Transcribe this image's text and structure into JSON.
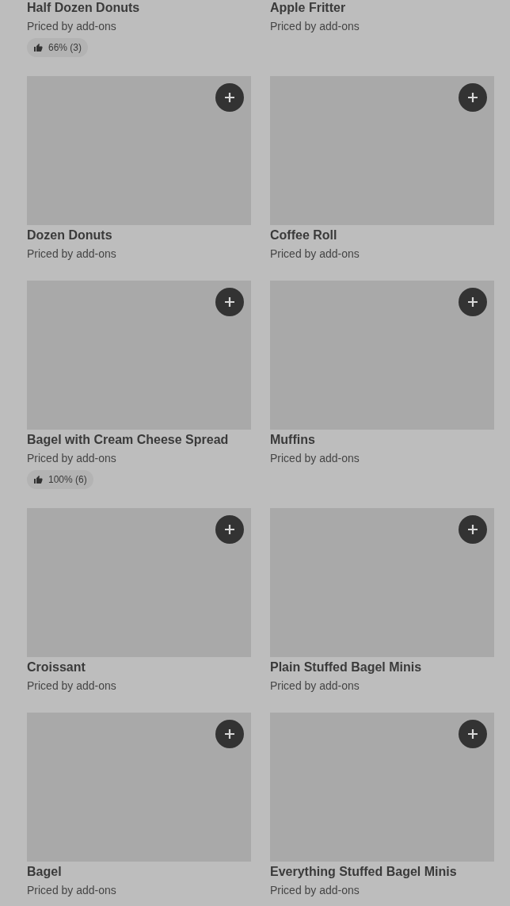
{
  "items": [
    {
      "kind": "partial",
      "name": "Half Dozen Donuts",
      "subtitle": "Priced by add-ons",
      "rating": "66% (3)"
    },
    {
      "kind": "partial",
      "name": "Apple Fritter",
      "subtitle": "Priced by add-ons"
    },
    {
      "kind": "full",
      "name": "Dozen Donuts",
      "subtitle": "Priced by add-ons"
    },
    {
      "kind": "full",
      "name": "Coffee Roll",
      "subtitle": "Priced by add-ons"
    },
    {
      "kind": "full",
      "name": "Bagel with Cream Cheese Spread",
      "subtitle": "Priced by add-ons",
      "rating": "100% (6)"
    },
    {
      "kind": "full",
      "name": "Muffins",
      "subtitle": "Priced by add-ons"
    },
    {
      "kind": "full",
      "name": "Croissant",
      "subtitle": "Priced by add-ons"
    },
    {
      "kind": "full",
      "name": "Plain Stuffed Bagel Minis",
      "subtitle": "Priced by add-ons"
    },
    {
      "kind": "full",
      "name": "Bagel",
      "subtitle": "Priced by add-ons"
    },
    {
      "kind": "full",
      "name": "Everything Stuffed Bagel Minis",
      "subtitle": "Priced by add-ons"
    }
  ]
}
